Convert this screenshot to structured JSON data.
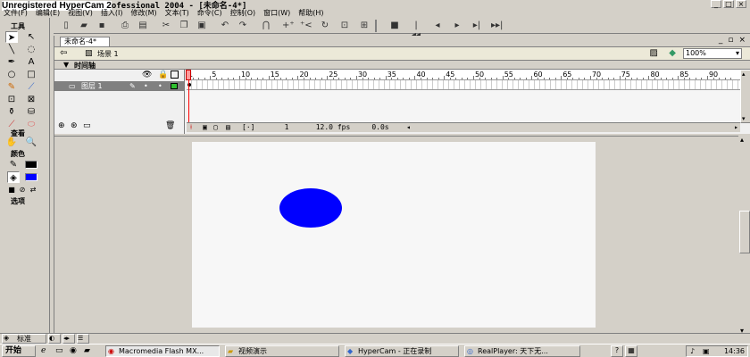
{
  "window": {
    "title_prefix": "Unregistered HyperCam 2",
    "title_rest": "ofessional 2004 - [未命名-4*]",
    "buttons": [
      "_",
      "□",
      "×"
    ]
  },
  "menu": [
    "文件(F)",
    "编辑(E)",
    "视图(V)",
    "插入(I)",
    "修改(M)",
    "文本(T)",
    "命令(C)",
    "控制(O)",
    "窗口(W)",
    "帮助(H)"
  ],
  "tools_panel": {
    "title": "工具",
    "view_title": "查看",
    "colors_title": "颜色",
    "options_title": "选项",
    "stroke_color": "#000000",
    "fill_color": "#0000ff"
  },
  "document": {
    "tab": "未命名-4*",
    "scene": "场景 1",
    "zoom": "100%"
  },
  "timeline": {
    "title": "时间轴",
    "layer_name": "图层 1",
    "ruler_labels": [
      "1",
      "5",
      "10",
      "15",
      "20",
      "25",
      "30",
      "35",
      "40",
      "45",
      "50",
      "55",
      "60",
      "65",
      "70",
      "75",
      "80",
      "85",
      "90"
    ],
    "current_frame": "1",
    "fps": "12.0 fps",
    "time": "0.0s"
  },
  "stage": {
    "background": "#f7f7f7",
    "shape_color": "#0000ff"
  },
  "panel_bar": {
    "label": "标准"
  },
  "taskbar": {
    "start": "开始",
    "tasks": [
      "Macromedia Flash MX...",
      "视频演示",
      "HyperCam - 正在录制",
      "RealPlayer: 天下无..."
    ],
    "clock": "14:36"
  }
}
